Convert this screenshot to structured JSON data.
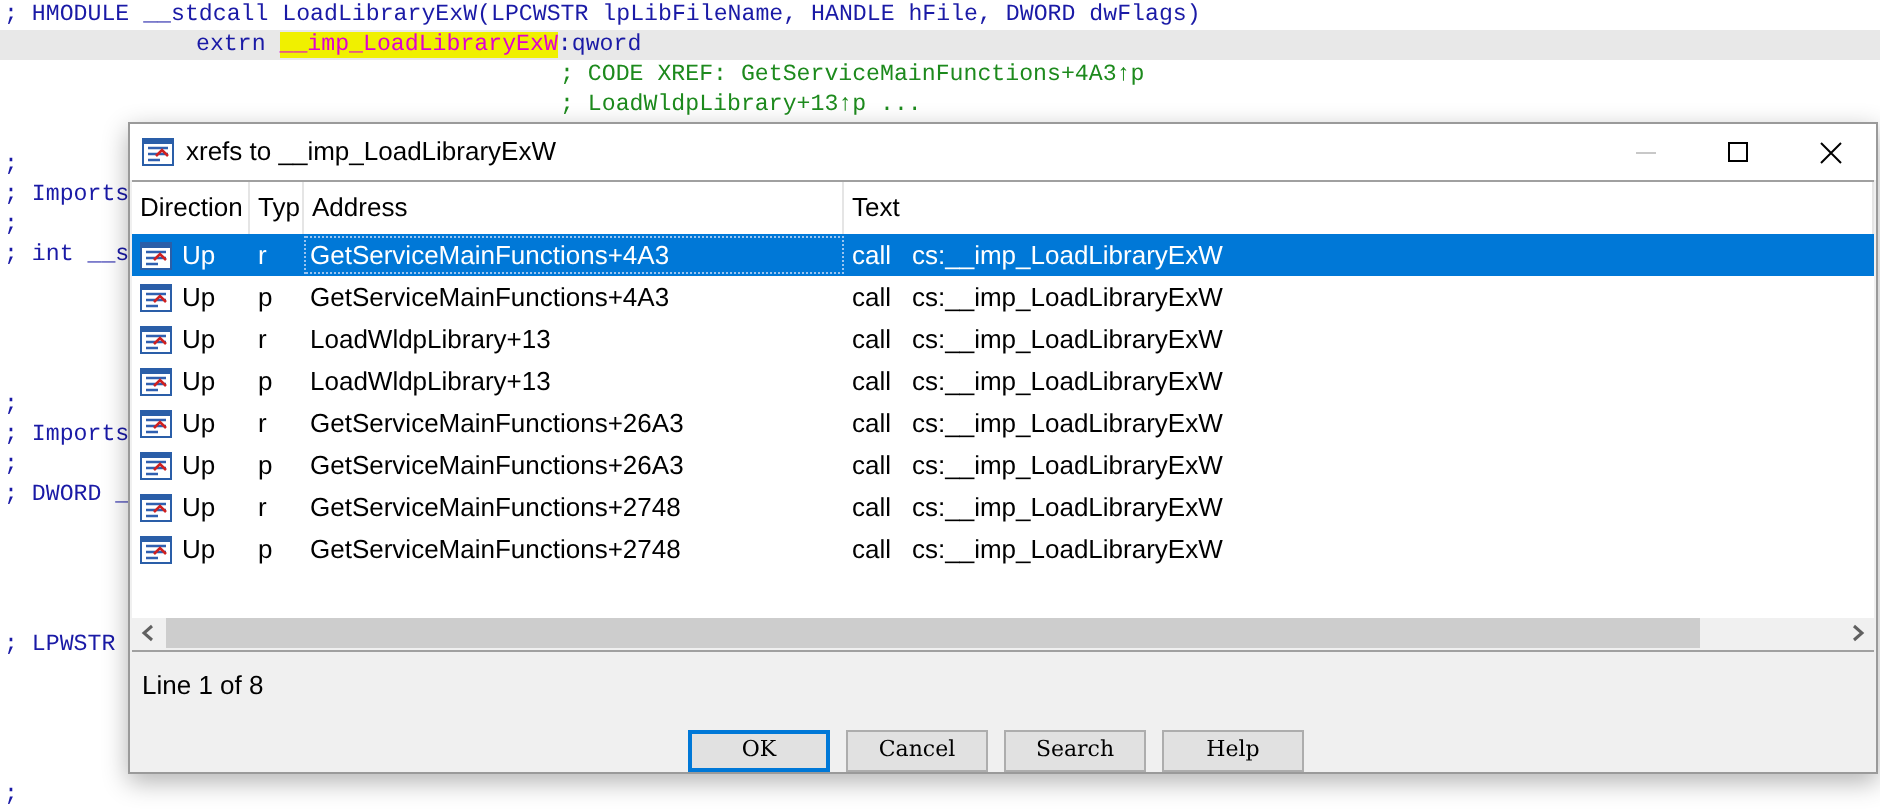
{
  "code_lines": [
    {
      "kind": "comment",
      "segments": [
        {
          "text": "; HMODULE __stdcall LoadLibraryExW(LPCWSTR lpLibFileName, HANDLE hFile, DWORD dwFlags)",
          "kind": "plain"
        }
      ]
    },
    {
      "kind": "extern",
      "segments": [
        {
          "text": "extrn ",
          "kind": "plain"
        },
        {
          "text": "__imp_LoadLibraryExW",
          "kind": "highlight"
        },
        {
          "text": ":qword",
          "kind": "plain"
        }
      ]
    },
    {
      "kind": "xref",
      "segments": [
        {
          "text": "; CODE XREF: GetServiceMainFunctions+4A3↑p",
          "kind": "plain"
        }
      ]
    },
    {
      "kind": "xref",
      "segments": [
        {
          "text": "; LoadWldpLibrary+13↑p ...",
          "kind": "plain"
        }
      ]
    },
    {
      "kind": "blank"
    },
    {
      "kind": "comment",
      "segments": [
        {
          "text": ";",
          "kind": "plain"
        }
      ]
    },
    {
      "kind": "comment",
      "segments": [
        {
          "text": "; Imports",
          "kind": "plain"
        }
      ]
    },
    {
      "kind": "comment",
      "segments": [
        {
          "text": ";",
          "kind": "plain"
        }
      ]
    },
    {
      "kind": "comment",
      "segments": [
        {
          "text": "; int __s",
          "kind": "plain"
        }
      ]
    },
    {
      "kind": "blank"
    },
    {
      "kind": "blank"
    },
    {
      "kind": "blank"
    },
    {
      "kind": "blank"
    },
    {
      "kind": "comment",
      "segments": [
        {
          "text": ";",
          "kind": "plain"
        }
      ]
    },
    {
      "kind": "comment",
      "segments": [
        {
          "text": "; Imports",
          "kind": "plain"
        }
      ]
    },
    {
      "kind": "comment",
      "segments": [
        {
          "text": ";",
          "kind": "plain"
        }
      ]
    },
    {
      "kind": "comment",
      "segments": [
        {
          "text": "; DWORD _",
          "kind": "plain"
        }
      ]
    },
    {
      "kind": "blank"
    },
    {
      "kind": "blank"
    },
    {
      "kind": "blank"
    },
    {
      "kind": "blank"
    },
    {
      "kind": "comment",
      "segments": [
        {
          "text": "; LPWSTR",
          "kind": "plain"
        }
      ]
    },
    {
      "kind": "blank"
    },
    {
      "kind": "blank"
    },
    {
      "kind": "blank"
    },
    {
      "kind": "blank"
    },
    {
      "kind": "comment",
      "segments": [
        {
          "text": ";",
          "kind": "plain"
        }
      ]
    }
  ],
  "dialog": {
    "title": "xrefs to __imp_LoadLibraryExW",
    "columns": [
      "Direction",
      "Typ",
      "Address",
      "Text"
    ],
    "rows": [
      {
        "direction": "Up",
        "type": "r",
        "address": "GetServiceMainFunctions+4A3",
        "instruction": "call",
        "operand": "cs:__imp_LoadLibraryExW",
        "selected": true
      },
      {
        "direction": "Up",
        "type": "p",
        "address": "GetServiceMainFunctions+4A3",
        "instruction": "call",
        "operand": "cs:__imp_LoadLibraryExW",
        "selected": false
      },
      {
        "direction": "Up",
        "type": "r",
        "address": "LoadWldpLibrary+13",
        "instruction": "call",
        "operand": "cs:__imp_LoadLibraryExW",
        "selected": false
      },
      {
        "direction": "Up",
        "type": "p",
        "address": "LoadWldpLibrary+13",
        "instruction": "call",
        "operand": "cs:__imp_LoadLibraryExW",
        "selected": false
      },
      {
        "direction": "Up",
        "type": "r",
        "address": "GetServiceMainFunctions+26A3",
        "instruction": "call",
        "operand": "cs:__imp_LoadLibraryExW",
        "selected": false
      },
      {
        "direction": "Up",
        "type": "p",
        "address": "GetServiceMainFunctions+26A3",
        "instruction": "call",
        "operand": "cs:__imp_LoadLibraryExW",
        "selected": false
      },
      {
        "direction": "Up",
        "type": "r",
        "address": "GetServiceMainFunctions+2748",
        "instruction": "call",
        "operand": "cs:__imp_LoadLibraryExW",
        "selected": false
      },
      {
        "direction": "Up",
        "type": "p",
        "address": "GetServiceMainFunctions+2748",
        "instruction": "call",
        "operand": "cs:__imp_LoadLibraryExW",
        "selected": false
      }
    ],
    "status": "Line 1 of 8",
    "buttons": [
      {
        "label": "OK",
        "selected": true
      },
      {
        "label": "Cancel",
        "selected": false
      },
      {
        "label": "Search",
        "selected": false
      },
      {
        "label": "Help",
        "selected": false
      }
    ]
  }
}
